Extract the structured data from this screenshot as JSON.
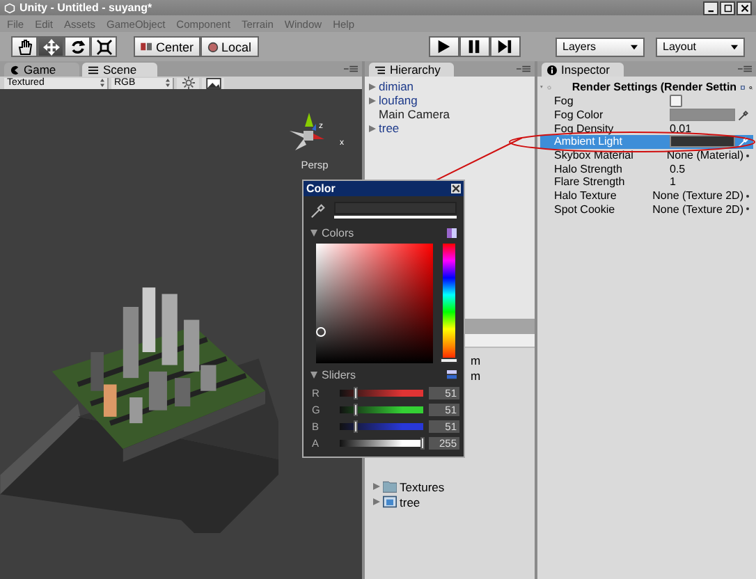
{
  "window": {
    "title": "Unity - Untitled - suyang*"
  },
  "menu": [
    "File",
    "Edit",
    "Assets",
    "GameObject",
    "Component",
    "Terrain",
    "Window",
    "Help"
  ],
  "toolbar": {
    "tools": [
      {
        "kind": "hand",
        "selected": false
      },
      {
        "kind": "move",
        "selected": true
      },
      {
        "kind": "rotate",
        "selected": false
      },
      {
        "kind": "scale",
        "selected": false
      }
    ],
    "pivot": [
      "Center",
      "Local"
    ],
    "play": [
      {
        "kind": "play",
        "selected": false
      },
      {
        "kind": "pause",
        "selected": false
      },
      {
        "kind": "step",
        "selected": false
      }
    ],
    "dropdowns": [
      "Layers",
      "Layout"
    ]
  },
  "scene": {
    "tabs": [
      {
        "label": "Game",
        "kind": "game",
        "selected": false
      },
      {
        "label": "Scene",
        "kind": "scene",
        "selected": true
      }
    ],
    "render_mode": "Textured",
    "channel": "RGB",
    "gizmo_axes": [
      "z",
      "x"
    ],
    "gizmo_label": "Persp"
  },
  "hierarchy": {
    "tab": "Hierarchy",
    "items": [
      {
        "label": "dimian",
        "kind": "prefab",
        "expandable": true
      },
      {
        "label": "loufang",
        "kind": "prefab",
        "expandable": true
      },
      {
        "label": "Main Camera",
        "kind": "object",
        "expandable": false
      },
      {
        "label": "tree",
        "kind": "prefab",
        "expandable": true
      }
    ]
  },
  "project": {
    "partial_items": [
      "m",
      "m"
    ],
    "items": [
      {
        "label": "Textures",
        "kind": "folder"
      },
      {
        "label": "tree",
        "kind": "prefab"
      }
    ]
  },
  "inspector": {
    "tab": "Inspector",
    "header": "Render Settings (Render Settin",
    "properties": [
      {
        "label": "Fog",
        "kind": "checkbox",
        "checked": false,
        "selected": false
      },
      {
        "label": "Fog Color",
        "kind": "color",
        "color": "#8c8c8c",
        "selected": false
      },
      {
        "label": "Fog Density",
        "kind": "text",
        "value": "0.01",
        "selected": false
      },
      {
        "label": "Ambient Light",
        "kind": "color",
        "color": "#333333",
        "selected": true
      },
      {
        "label": "Skybox Material",
        "kind": "object",
        "value": "None (Material)",
        "selected": false
      },
      {
        "label": "Halo Strength",
        "kind": "text",
        "value": "0.5",
        "selected": false
      },
      {
        "label": "Flare Strength",
        "kind": "text",
        "value": "1",
        "selected": false
      },
      {
        "label": "Halo Texture",
        "kind": "object",
        "value": "None (Texture 2D)",
        "selected": false
      },
      {
        "label": "Spot Cookie",
        "kind": "object",
        "value": "None (Texture 2D)",
        "selected": false
      }
    ]
  },
  "color_picker": {
    "title": "Color",
    "colors_header": "Colors",
    "hue": {
      "level": 0
    },
    "sliders_header": "Sliders",
    "sliders": [
      {
        "label": "R",
        "color": "#e03434",
        "level": 0.2,
        "value": "51"
      },
      {
        "label": "G",
        "color": "#34d034",
        "level": 0.2,
        "value": "51"
      },
      {
        "label": "B",
        "color": "#2838d8",
        "level": 0.2,
        "value": "51"
      },
      {
        "label": "A",
        "color": "#ffffff",
        "level": 1,
        "value": "255"
      }
    ]
  }
}
